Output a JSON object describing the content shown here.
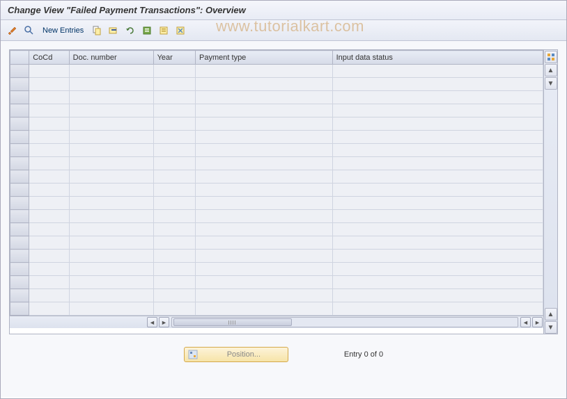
{
  "title": "Change View \"Failed Payment Transactions\": Overview",
  "watermark": "www.tutorialkart.com",
  "toolbar": {
    "new_entries_label": "New Entries"
  },
  "table": {
    "columns": {
      "cocd": "CoCd",
      "docnum": "Doc. number",
      "year": "Year",
      "ptype": "Payment type",
      "status": "Input data status"
    },
    "rows": [
      {},
      {},
      {},
      {},
      {},
      {},
      {},
      {},
      {},
      {},
      {},
      {},
      {},
      {},
      {},
      {},
      {},
      {},
      {}
    ]
  },
  "footer": {
    "position_label": "Position...",
    "entry_count": "Entry 0 of 0"
  }
}
